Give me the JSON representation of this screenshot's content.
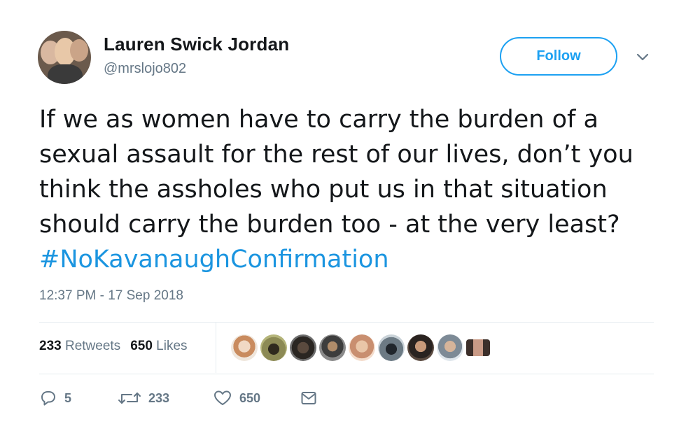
{
  "author": {
    "display_name": "Lauren Swick Jordan",
    "handle": "@mrslojo802"
  },
  "follow_button": {
    "label": "Follow"
  },
  "tweet": {
    "text_plain": "If we as women have to carry the burden of a sexual assault for the rest of our lives, don’t you think the assholes who put us in that situation should carry the burden too - at the very least?",
    "hashtag": "#NoKavanaughConfirmation",
    "timestamp": "12:37 PM - 17 Sep 2018"
  },
  "stats": {
    "retweets_count": "233",
    "retweets_label": "Retweets",
    "likes_count": "650",
    "likes_label": "Likes"
  },
  "actions": {
    "reply_count": "5",
    "retweet_count": "233",
    "like_count": "650"
  },
  "colors": {
    "accent": "#1da1f2",
    "hashtag": "#1b95e0",
    "secondary_text": "#657786",
    "divider": "#e6ecf0"
  },
  "icons": [
    "caret-down-icon",
    "reply-icon",
    "retweet-icon",
    "like-icon",
    "direct-message-icon"
  ]
}
